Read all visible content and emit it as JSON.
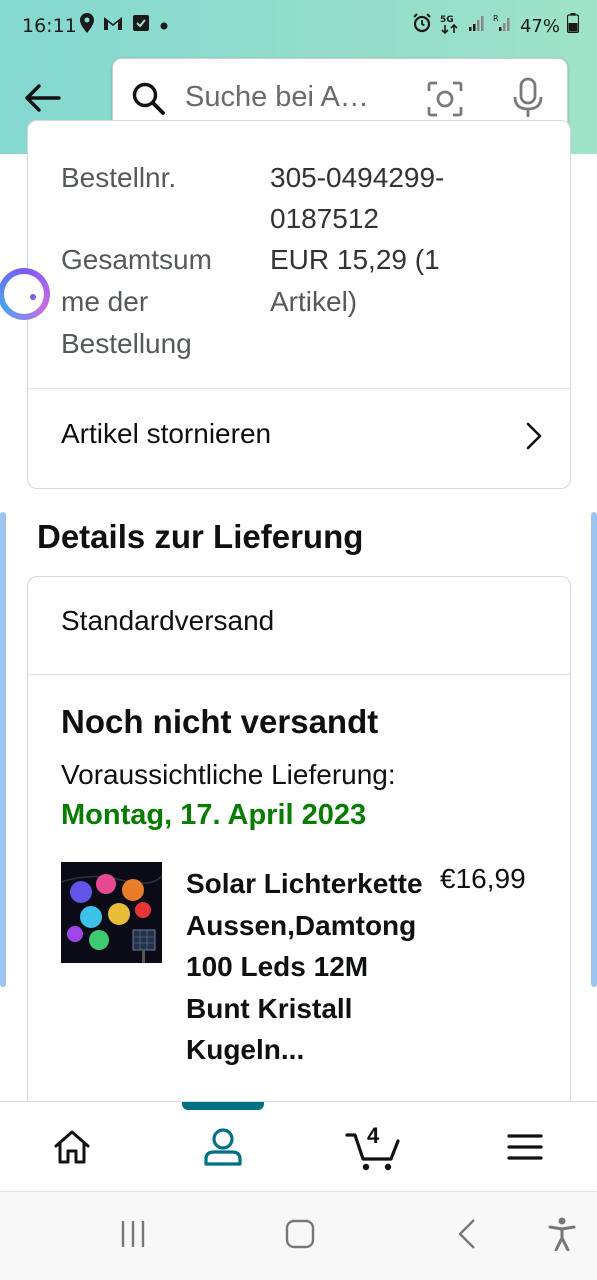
{
  "status_bar": {
    "time": "16:11",
    "battery": "47%",
    "network": "5G"
  },
  "header": {
    "search_placeholder": "Suche bei A…"
  },
  "order_summary": {
    "order_number_label": "Bestellnr.",
    "order_number_line1": "305-0494299-",
    "order_number_line2": "0187512",
    "total_label_line1": "Gesamtsum",
    "total_label_line2": "me der",
    "total_label_line3": "Bestellung",
    "total_value_line1": "EUR 15,29 (1",
    "total_value_line2": "Artikel)",
    "cancel_label": "Artikel stornieren"
  },
  "delivery": {
    "section_title": "Details zur Lieferung",
    "shipping_method": "Standardversand",
    "status": "Noch nicht versandt",
    "eta_label": "Voraussichtliche Lieferung:",
    "eta_date": "Montag, 17. April 2023",
    "product_title": "Solar Lichterkette Aussen,Damtong 100 Leds 12M Bunt Kristall Kugeln...",
    "product_price": "€16,99"
  },
  "bottom_nav": {
    "cart_count": "4",
    "items": [
      "home-icon",
      "account-icon",
      "cart-icon",
      "menu-icon"
    ],
    "active": "account"
  },
  "colors": {
    "header_gradient_start": "#84d8d0",
    "header_gradient_end": "#9fe2c8",
    "eta_green": "#067d00",
    "active_teal": "#007185"
  }
}
